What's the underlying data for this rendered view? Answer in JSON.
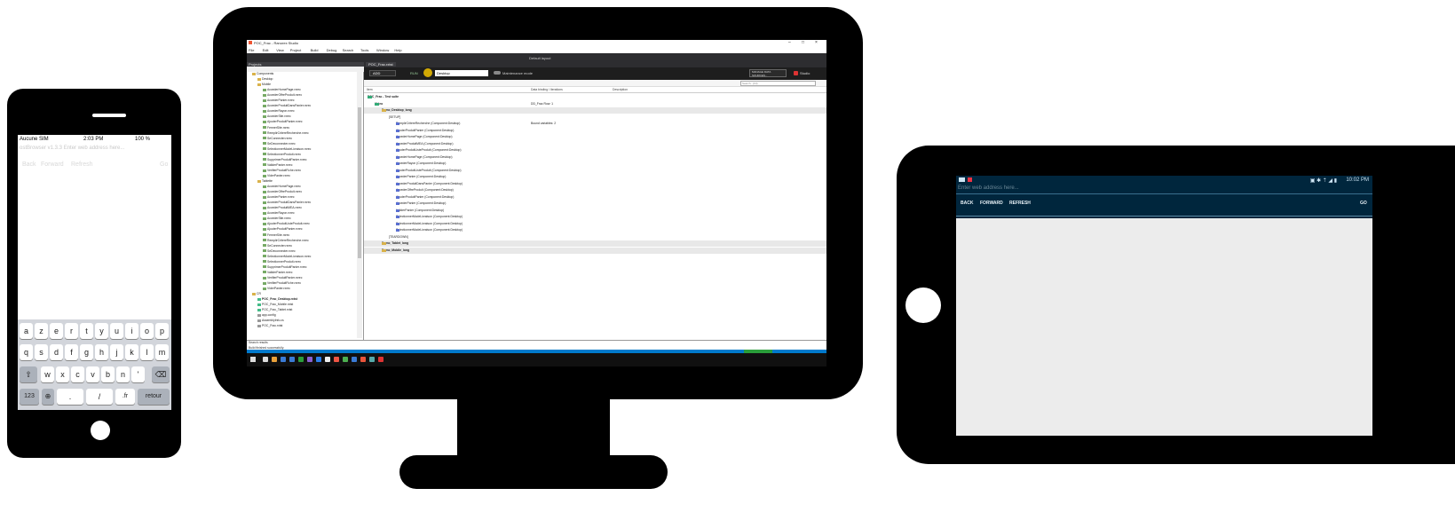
{
  "phone": {
    "status": {
      "carrier": "Aucune SIM",
      "time": "2:03 PM",
      "battery": "100 %"
    },
    "url_placeholder": "ostBrowser v1.3.3 Enter web address here...",
    "nav": {
      "back": "Back",
      "forward": "Forward",
      "refresh": "Refresh",
      "go": "Go"
    },
    "keyboard": {
      "row1": [
        "a",
        "z",
        "e",
        "r",
        "t",
        "y",
        "u",
        "i",
        "o",
        "p"
      ],
      "row2": [
        "q",
        "s",
        "d",
        "f",
        "g",
        "h",
        "j",
        "k",
        "l",
        "m"
      ],
      "row3": [
        "w",
        "x",
        "c",
        "v",
        "b",
        "n",
        "'"
      ],
      "numbers": "123",
      "space": ".",
      "slash": "/",
      "tld": ".fr",
      "return": "retour"
    }
  },
  "desktop": {
    "window_title": "POC_Frac - Ranorex Studio",
    "menu": [
      "File",
      "Edit",
      "View",
      "Project",
      "Build",
      "Debug",
      "Search",
      "Tools",
      "Window",
      "Help"
    ],
    "toolbar": {
      "layout": "Default layout"
    },
    "projects_header": "Projects",
    "tree": [
      {
        "label": "Components",
        "type": "folder",
        "indent": 0
      },
      {
        "label": "Desktop",
        "type": "folder",
        "indent": 1
      },
      {
        "label": "Mobile",
        "type": "folder",
        "indent": 1
      },
      {
        "label": "AccederHomePage.rxrec",
        "type": "file",
        "indent": 2
      },
      {
        "label": "AccederOffreProduit.rxrec",
        "type": "file",
        "indent": 2
      },
      {
        "label": "AccederPanier.rxrec",
        "type": "file",
        "indent": 2
      },
      {
        "label": "AccederProduitDansPanier.rxrec",
        "type": "file",
        "indent": 2
      },
      {
        "label": "AccederRayon.rxrec",
        "type": "file",
        "indent": 2
      },
      {
        "label": "AccederSite.rxrec",
        "type": "file",
        "indent": 2
      },
      {
        "label": "AjouterProduitPanier.rxrec",
        "type": "file",
        "indent": 2
      },
      {
        "label": "FermerSite.rxrec",
        "type": "file",
        "indent": 2
      },
      {
        "label": "RemplirCritereRecherche.rxrec",
        "type": "file",
        "indent": 2
      },
      {
        "label": "SeConnecter.rxrec",
        "type": "file",
        "indent": 2
      },
      {
        "label": "SeDeconnecter.rxrec",
        "type": "file",
        "indent": 2
      },
      {
        "label": "SelectionnerModeLivraison.rxrec",
        "type": "file",
        "indent": 2
      },
      {
        "label": "SelectionnerProduit.rxrec",
        "type": "file",
        "indent": 2
      },
      {
        "label": "SupprimerProduitPanier.rxrec",
        "type": "file",
        "indent": 2
      },
      {
        "label": "ValiderPanier.rxrec",
        "type": "file",
        "indent": 2
      },
      {
        "label": "VerifierProduitFiche.rxrec",
        "type": "file",
        "indent": 2
      },
      {
        "label": "ViderPanier.rxrec",
        "type": "file",
        "indent": 2
      },
      {
        "label": "Tablette",
        "type": "folder",
        "indent": 1
      },
      {
        "label": "AccederHomePage.rxrec",
        "type": "file",
        "indent": 2
      },
      {
        "label": "AccederOffreProduit.rxrec",
        "type": "file",
        "indent": 2
      },
      {
        "label": "AccederPanier.rxrec",
        "type": "file",
        "indent": 2
      },
      {
        "label": "AccederProduitDansPanier.rxrec",
        "type": "file",
        "indent": 2
      },
      {
        "label": "AccederProduitMEA.rxrec",
        "type": "file",
        "indent": 2
      },
      {
        "label": "AccederRayon.rxrec",
        "type": "file",
        "indent": 2
      },
      {
        "label": "AccederSite.rxrec",
        "type": "file",
        "indent": 2
      },
      {
        "label": "AjouterProduitListeProduit.rxrec",
        "type": "file",
        "indent": 2
      },
      {
        "label": "AjouterProduitPanier.rxrec",
        "type": "file",
        "indent": 2
      },
      {
        "label": "FermerSite.rxrec",
        "type": "file",
        "indent": 2
      },
      {
        "label": "RemplirCritereRecherche.rxrec",
        "type": "file",
        "indent": 2
      },
      {
        "label": "SeConnecter.rxrec",
        "type": "file",
        "indent": 2
      },
      {
        "label": "SeDeconnecter.rxrec",
        "type": "file",
        "indent": 2
      },
      {
        "label": "SelectionnerModeLivraison.rxrec",
        "type": "file",
        "indent": 2
      },
      {
        "label": "SelectionnerProduit.rxrec",
        "type": "file",
        "indent": 2
      },
      {
        "label": "SupprimerProduitPanier.rxrec",
        "type": "file",
        "indent": 2
      },
      {
        "label": "ValiderPanier.rxrec",
        "type": "file",
        "indent": 2
      },
      {
        "label": "VerifierProduitPanier.rxrec",
        "type": "file",
        "indent": 2
      },
      {
        "label": "VerifierProduitFiche.rxrec",
        "type": "file",
        "indent": 2
      },
      {
        "label": "ViderPanier.rxrec",
        "type": "file",
        "indent": 2
      },
      {
        "label": "CR",
        "type": "folder",
        "indent": 0
      },
      {
        "label": "POC_Frac_Desktop.rxtst",
        "type": "test",
        "indent": 1
      },
      {
        "label": "POC_Frac_Mobile.rxtst",
        "type": "test",
        "indent": 1
      },
      {
        "label": "POC_Frac_Tablet.rxtst",
        "type": "test",
        "indent": 1
      },
      {
        "label": "app.config",
        "type": "plain",
        "indent": 1
      },
      {
        "label": "AssemblyInfo.cs",
        "type": "plain",
        "indent": 1
      },
      {
        "label": "POC_Frac.rxtst",
        "type": "plain",
        "indent": 1
      }
    ],
    "editor_tab": "POC_Frac.rxtst",
    "add_button": "ADD",
    "run_button": "RUN",
    "run_tooltip": "Run (F5)",
    "environment": "Desktop",
    "maintenance_mode": "Maintenance mode",
    "manage_data_sources": "MANAGE DATA SOURCES...",
    "studio": "Studio",
    "search_placeholder": "Search...(F3)",
    "columns": {
      "item": "Item",
      "data": "Data binding / Iterations",
      "desc": "Description"
    },
    "rows": [
      {
        "name": "POC_Frac - Test suite",
        "data": "",
        "kind": "suite",
        "indent": 0,
        "bold": true
      },
      {
        "name": "Video",
        "data": "DD_Frac  Row: 1",
        "kind": "suite",
        "indent": 1,
        "bold": true
      },
      {
        "name": "Demo_Desktop_long",
        "data": "",
        "kind": "case",
        "indent": 2,
        "bold": true,
        "highlight": true
      },
      {
        "name": "[SETUP]",
        "data": "",
        "kind": "none",
        "indent": 3
      },
      {
        "name": "RemplirCritereRecherche  (Component:Desktop)",
        "data": "Bound variables: 2",
        "kind": "mod",
        "indent": 4
      },
      {
        "name": "AjouterProduitPanier  (Component:Desktop)",
        "data": "",
        "kind": "mod",
        "indent": 4
      },
      {
        "name": "AccederHomePage  (Component:Desktop)",
        "data": "",
        "kind": "mod",
        "indent": 4
      },
      {
        "name": "AccederProduitMEA  (Component:Desktop)",
        "data": "",
        "kind": "mod",
        "indent": 4
      },
      {
        "name": "AjouterProduitListeProduit  (Component:Desktop)",
        "data": "",
        "kind": "mod",
        "indent": 4
      },
      {
        "name": "AccederHomePage  (Component:Desktop)",
        "data": "",
        "kind": "mod",
        "indent": 4
      },
      {
        "name": "AccederRayon  (Component:Desktop)",
        "data": "",
        "kind": "mod",
        "indent": 4
      },
      {
        "name": "AjouterProduitListeProduit  (Component:Desktop)",
        "data": "",
        "kind": "mod",
        "indent": 4
      },
      {
        "name": "AccederPanier  (Component:Desktop)",
        "data": "",
        "kind": "mod",
        "indent": 4
      },
      {
        "name": "AccederProduitDansPanier  (Component:Desktop)",
        "data": "",
        "kind": "mod",
        "indent": 4
      },
      {
        "name": "AccederOffreProduit  (Component:Desktop)",
        "data": "",
        "kind": "mod",
        "indent": 4
      },
      {
        "name": "AjouterProduitPanier  (Component:Desktop)",
        "data": "",
        "kind": "mod",
        "indent": 4
      },
      {
        "name": "AccederPanier  (Component:Desktop)",
        "data": "",
        "kind": "mod",
        "indent": 4
      },
      {
        "name": "ValiderPanier  (Component:Desktop)",
        "data": "",
        "kind": "mod",
        "indent": 4
      },
      {
        "name": "SelectionnerModeLivraison  (Component:Desktop)",
        "data": "",
        "kind": "mod",
        "indent": 4
      },
      {
        "name": "SelectionnerModeLivraison  (Component:Desktop)",
        "data": "",
        "kind": "mod",
        "indent": 4
      },
      {
        "name": "SelectionnerModeLivraison  (Component:Desktop)",
        "data": "",
        "kind": "mod",
        "indent": 4
      },
      {
        "name": "[TEARDOWN]",
        "data": "",
        "kind": "none",
        "indent": 3
      },
      {
        "name": "Demo_Tablet_long",
        "data": "",
        "kind": "case",
        "indent": 2,
        "bold": true,
        "highlight": true
      },
      {
        "name": "Demo_Mobile_long",
        "data": "",
        "kind": "case",
        "indent": 2,
        "bold": true,
        "highlight": true
      }
    ],
    "output_title": "Search results",
    "output_text": "Build finished successfully."
  },
  "tablet": {
    "time": "10:02 PM",
    "url_placeholder": "Enter web address here...",
    "nav": {
      "back": "BACK",
      "forward": "FORWARD",
      "refresh": "REFRESH",
      "go": "GO"
    }
  }
}
